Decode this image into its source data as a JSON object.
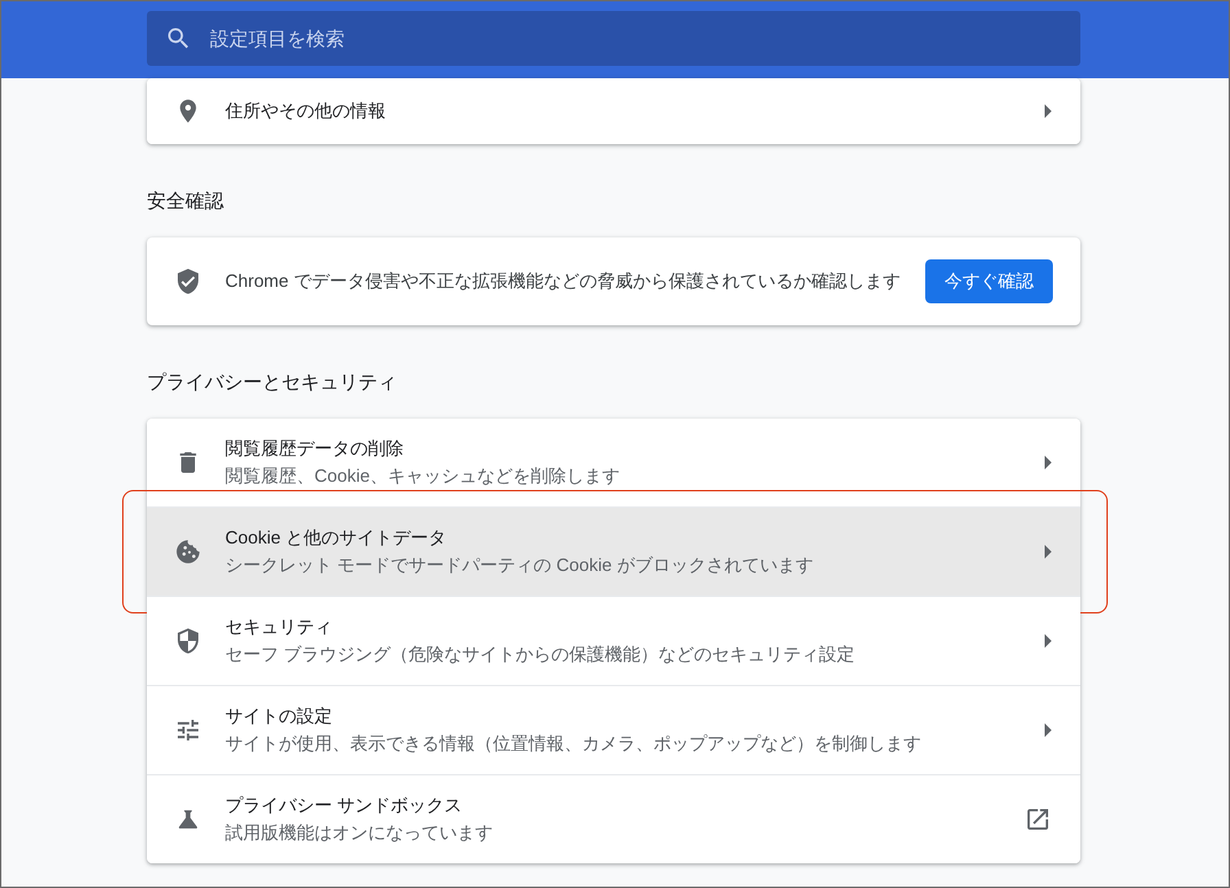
{
  "search": {
    "placeholder": "設定項目を検索"
  },
  "sections": [
    {
      "kind": "list",
      "rows": [
        {
          "kind": "page",
          "title": "住所やその他の情報",
          "selected": false,
          "annotated": false
        }
      ]
    },
    {
      "kind": "check",
      "heading": "安全確認",
      "text": "Chrome でデータ侵害や不正な拡張機能などの脅威から保護されているか確認します",
      "button": "今すぐ確認"
    },
    {
      "kind": "list",
      "heading": "プライバシーとセキュリティ",
      "rows": [
        {
          "kind": "page",
          "title": "閲覧履歴データの削除",
          "subtitle": "閲覧履歴、Cookie、キャッシュなどを削除します",
          "selected": false,
          "annotated": false
        },
        {
          "kind": "page",
          "title": "Cookie と他のサイトデータ",
          "subtitle": "シークレット モードでサードパーティの Cookie がブロックされています",
          "selected": true,
          "annotated": true
        },
        {
          "kind": "page",
          "title": "セキュリティ",
          "subtitle": "セーフ ブラウジング（危険なサイトからの保護機能）などのセキュリティ設定",
          "selected": false,
          "annotated": false
        },
        {
          "kind": "page",
          "title": "サイトの設定",
          "subtitle": "サイトが使用、表示できる情報（位置情報、カメラ、ポップアップなど）を制御します",
          "selected": false,
          "annotated": false
        },
        {
          "kind": "external",
          "title": "プライバシー サンドボックス",
          "subtitle": "試用版機能はオンになっています",
          "selected": false,
          "annotated": false
        }
      ]
    }
  ]
}
